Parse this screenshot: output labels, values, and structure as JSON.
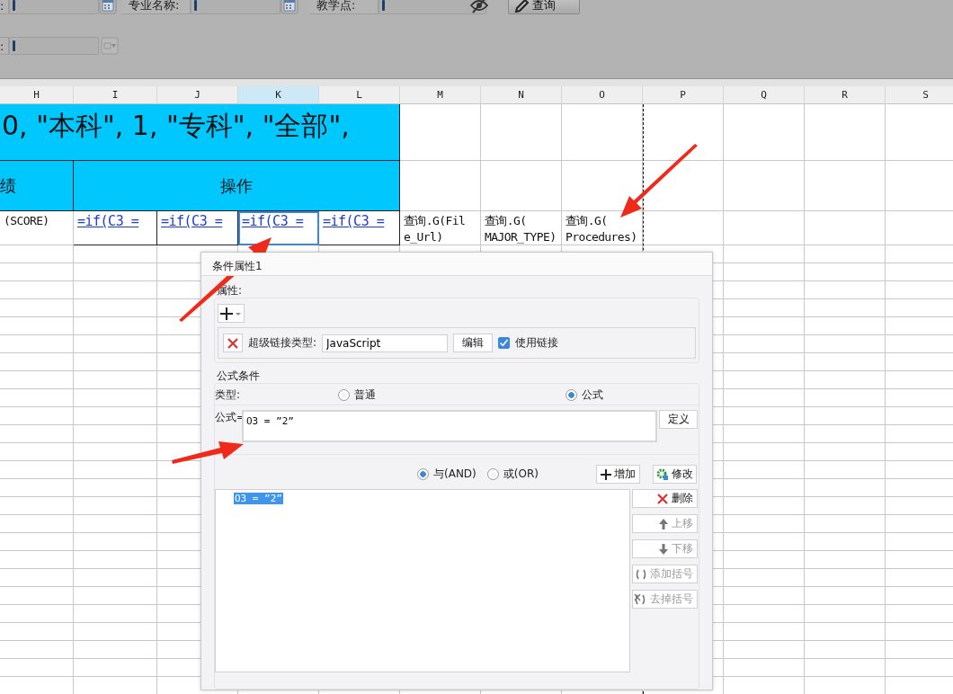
{
  "params": [
    {
      "fields": [
        {
          "label": ":",
          "kind": "date"
        },
        {
          "label": "专业名称:",
          "kind": "date"
        },
        {
          "label": "教学点:",
          "kind": "hidden"
        }
      ],
      "button": "查询"
    },
    {
      "fields": [
        {
          "label": ":",
          "kind": "select"
        }
      ]
    }
  ],
  "sheet": {
    "columns": [
      {
        "label": "H",
        "selected": false
      },
      {
        "label": "I",
        "selected": false
      },
      {
        "label": "J",
        "selected": false
      },
      {
        "label": "K",
        "selected": true
      },
      {
        "label": "L",
        "selected": false
      },
      {
        "label": "M",
        "selected": false
      },
      {
        "label": "N",
        "selected": false
      },
      {
        "label": "O",
        "selected": false
      },
      {
        "label": "P",
        "selected": false
      },
      {
        "label": "Q",
        "selected": false
      },
      {
        "label": "R",
        "selected": false
      },
      {
        "label": "S",
        "selected": false
      }
    ],
    "title_text": "0, \"本科\", 1, \"专科\", \"全部\",",
    "header_cells": [
      "绩",
      "操作"
    ],
    "row_cells": [
      {
        "kind": "plain",
        "lines": [
          "(SCORE)"
        ],
        "selected": false
      },
      {
        "kind": "formula",
        "lines": [
          "=if(C3 ="
        ],
        "selected": false
      },
      {
        "kind": "formula",
        "lines": [
          "=if(C3 ="
        ],
        "selected": false
      },
      {
        "kind": "formula",
        "lines": [
          "=if(C3 ="
        ],
        "selected": true
      },
      {
        "kind": "formula",
        "lines": [
          "=if(C3 ="
        ],
        "selected": false
      },
      {
        "kind": "plain",
        "lines": [
          "查询.G(Fil",
          "e_Url)"
        ],
        "selected": false
      },
      {
        "kind": "plain",
        "lines": [
          "查询.G(",
          "MAJOR_TYPE)"
        ],
        "selected": false
      },
      {
        "kind": "plain",
        "lines": [
          "查询.G(",
          "Procedures)"
        ],
        "selected": false
      }
    ]
  },
  "dialog": {
    "title": "条件属性1",
    "properties": {
      "heading": "属性:",
      "link_type_label": "超级链接类型:",
      "link_type": "JavaScript",
      "edit_button": "编辑",
      "use_link": {
        "label": "使用链接",
        "checked": true
      }
    },
    "condition": {
      "heading": "公式条件",
      "type_label": "类型:",
      "types": [
        {
          "label": "普通",
          "selected": false
        },
        {
          "label": "公式",
          "selected": true
        }
      ],
      "formula_label": "公式=",
      "formula": "O3 = ”2”",
      "define_button": "定义",
      "logic": [
        {
          "label": "与(AND)",
          "selected": true
        },
        {
          "label": "或(OR)",
          "selected": false
        }
      ],
      "add_button": "增加",
      "modify_button": "修改",
      "items": [
        {
          "text": "O3 = ”2”",
          "selected": true
        }
      ],
      "actions": [
        {
          "label": "删除",
          "kind": "delete",
          "disabled": false
        },
        {
          "label": "上移",
          "kind": "up",
          "disabled": true
        },
        {
          "label": "下移",
          "kind": "down",
          "disabled": true
        },
        {
          "label": "添加括号",
          "kind": "bracket",
          "disabled": true
        },
        {
          "label": "去掉括号",
          "kind": "unbracket",
          "disabled": true
        }
      ]
    }
  }
}
